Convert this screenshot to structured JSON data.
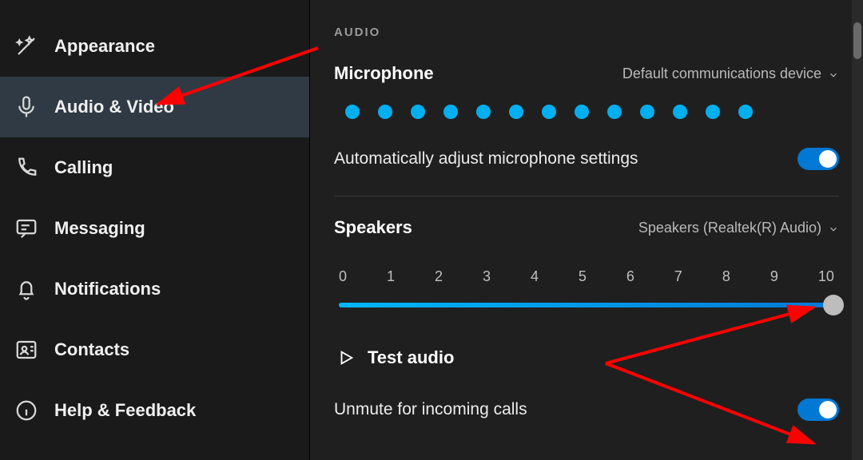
{
  "sidebar": {
    "items": [
      {
        "label": "Appearance"
      },
      {
        "label": "Audio & Video"
      },
      {
        "label": "Calling"
      },
      {
        "label": "Messaging"
      },
      {
        "label": "Notifications"
      },
      {
        "label": "Contacts"
      },
      {
        "label": "Help & Feedback"
      }
    ],
    "active_index": 1
  },
  "main": {
    "section_title": "AUDIO",
    "microphone": {
      "label": "Microphone",
      "device": "Default communications device",
      "level_dots": 13
    },
    "auto_adjust": {
      "label": "Automatically adjust microphone settings",
      "on": true
    },
    "speakers": {
      "label": "Speakers",
      "device": "Speakers (Realtek(R) Audio)",
      "ticks": [
        "0",
        "1",
        "2",
        "3",
        "4",
        "5",
        "6",
        "7",
        "8",
        "9",
        "10"
      ],
      "value": 10
    },
    "test_audio_label": "Test audio",
    "unmute": {
      "label": "Unmute for incoming calls",
      "on": true
    }
  },
  "colors": {
    "accent": "#0078d4",
    "accent_light": "#00aff0"
  }
}
